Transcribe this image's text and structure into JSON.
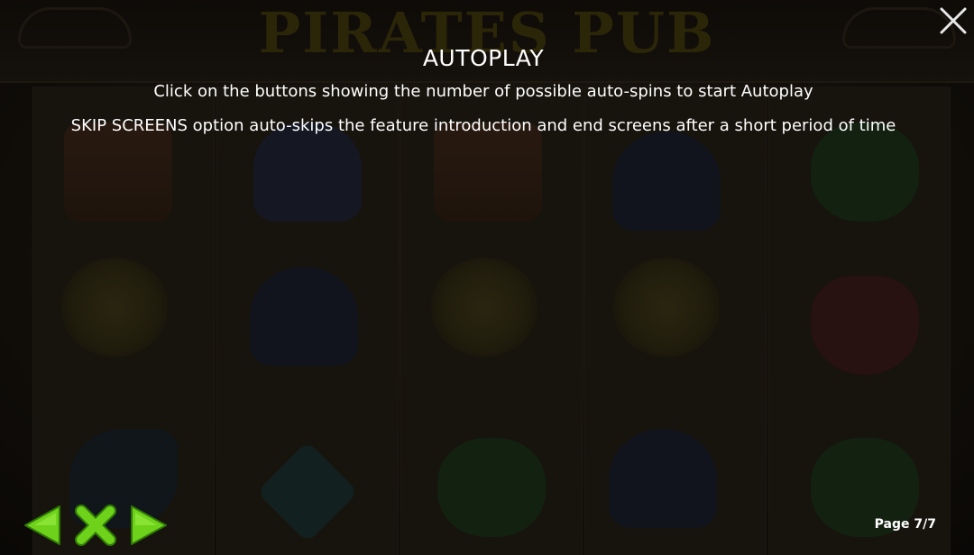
{
  "background": {
    "logo_text": "PIRATES PUB"
  },
  "help": {
    "title": "AUTOPLAY",
    "lines": [
      "Click on the buttons showing the number of possible auto-spins to start Autoplay",
      "SKIP SCREENS option auto-skips the feature introduction and end screens after a short period of time"
    ],
    "page_label": "Page 7/7",
    "current_page": 7,
    "total_pages": 7
  },
  "controls": {
    "close_icon": "close-icon",
    "prev_icon": "arrow-left-icon",
    "exit_icon": "x-icon",
    "next_icon": "arrow-right-icon",
    "accent_color": "#6fd21a",
    "accent_dark": "#2f7a07"
  }
}
